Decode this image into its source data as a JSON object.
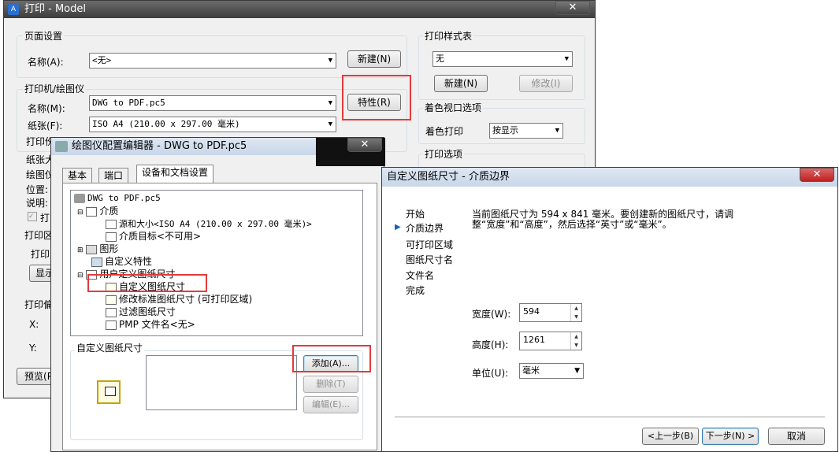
{
  "plot_dialog": {
    "title": "打印 - Model",
    "page_setup": {
      "group": "页面设置",
      "name_label": "名称(A):",
      "name_value": "<无>",
      "new_button": "新建(N)"
    },
    "printer": {
      "group": "打印机/绘图仪",
      "name_label": "名称(M):",
      "name_value": "DWG to PDF.pc5",
      "properties_button": "特性(R)",
      "paper_label": "纸张(F):",
      "paper_value": "ISO A4 (210.00 x 297.00 毫米)"
    },
    "partial_labels": [
      "打印份",
      "纸张大",
      "绘图仪",
      "位置:",
      "说明:",
      "打"
    ],
    "plot_area": {
      "group": "打印区",
      "what_label": "打印",
      "display_button": "显示"
    },
    "offset": {
      "group": "打印偏",
      "x_label": "X:",
      "y_label": "Y:"
    },
    "preview_button": "预览(P",
    "style_table": {
      "group": "打印样式表",
      "value": "无",
      "new_button": "新建(N)",
      "edit_button": "修改(I)"
    },
    "shaded": {
      "group": "着色视口选项",
      "label": "着色打印",
      "value": "按显示"
    },
    "options": {
      "group": "打印选项"
    }
  },
  "plotter_editor": {
    "title": "绘图仪配置编辑器 - DWG to PDF.pc5",
    "tabs": [
      "基本",
      "端口",
      "设备和文档设置"
    ],
    "tree": [
      {
        "text": "DWG to PDF.pc5"
      },
      {
        "text": "介质"
      },
      {
        "text": "源和大小<ISO A4 (210.00 x 297.00 毫米)>"
      },
      {
        "text": "介质目标<不可用>"
      },
      {
        "text": "图形"
      },
      {
        "text": "自定义特性"
      },
      {
        "text": "用户定义图纸尺寸"
      },
      {
        "text": "自定义图纸尺寸"
      },
      {
        "text": "修改标准图纸尺寸 (可打印区域)"
      },
      {
        "text": "过滤图纸尺寸"
      },
      {
        "text": "PMP 文件名<无>"
      }
    ],
    "custom_group": "自定义图纸尺寸",
    "add_button": "添加(A)...",
    "delete_button": "删除(T)",
    "edit_button": "编辑(E)..."
  },
  "wizard": {
    "title": "自定义图纸尺寸 - 介质边界",
    "steps": [
      "开始",
      "介质边界",
      "可打印区域",
      "图纸尺寸名",
      "文件名",
      "完成"
    ],
    "current_step": "介质边界",
    "description_1": "当前图纸尺寸为 594 x 841 毫米。要创建新的图纸尺寸，请调",
    "description_2": "整“宽度”和“高度”，然后选择“英寸”或“毫米”。",
    "width_label": "宽度(W):",
    "width_value": "594",
    "height_label": "高度(H):",
    "height_value": "1261",
    "unit_label": "单位(U):",
    "unit_value": "毫米",
    "back_button": "<上一步(B)",
    "next_button": "下一步(N) >",
    "cancel_button": "取消"
  },
  "colors": {
    "highlight_red": "#e33a3a",
    "dark_title": "#3d3d3d",
    "dialog_bg": "#f0f0f0"
  }
}
